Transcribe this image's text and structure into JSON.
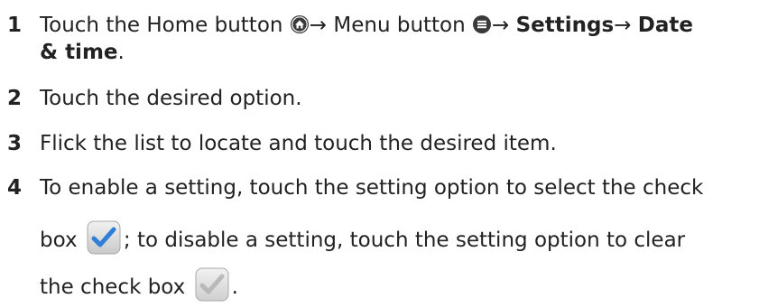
{
  "steps": [
    {
      "number": "1",
      "line1_a": "Touch the Home button ",
      "arrow1": "→ Menu button ",
      "arrow2": "→ ",
      "settings": "Settings",
      "arrow3": "→ ",
      "date": "Date",
      "line2_bold": "& time",
      "line2_end": "."
    },
    {
      "number": "2",
      "text": "Touch the desired option."
    },
    {
      "number": "3",
      "text": "Flick the list to locate and touch the desired item."
    },
    {
      "number": "4",
      "line1": "To enable a setting, touch the setting option to select the check",
      "line2_a": "box ",
      "line2_b": "; to disable a setting, touch the setting option to clear",
      "line3_a": "the check box ",
      "line3_b": "."
    }
  ],
  "icons": {
    "home": "home-icon",
    "menu": "menu-icon",
    "checked": "checkbox-checked-icon",
    "unchecked": "checkbox-unchecked-icon"
  },
  "colors": {
    "text": "#222222",
    "checkmark_blue": "#2f7fd9",
    "checkmark_gray": "#b9b9b9"
  }
}
